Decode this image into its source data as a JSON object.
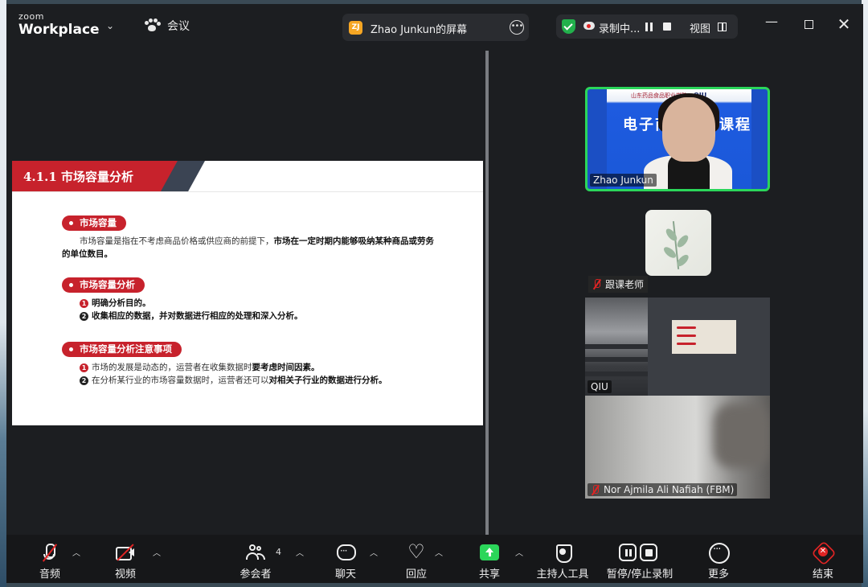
{
  "titlebar": {
    "brand_small": "zoom",
    "brand_big": "Workplace",
    "meeting_label": "会议",
    "share_badge": "ZJ",
    "share_title": "Zhao Junkun的屏幕",
    "recording_text": "录制中...",
    "view_label": "视图"
  },
  "slide": {
    "header": "4.1.1   市场容量分析",
    "s1_pill": "市场容量",
    "s1_text_plain": "市场容量是指在不考虑商品价格或供应商的前提下，",
    "s1_text_bold1": "市场在一定时期内能够吸纳某种商品或劳务",
    "s1_text_bold2": "的单位数目。",
    "s2_pill": "市场容量分析",
    "s2_item1": "明确分析目的。",
    "s2_item2": "收集相应的数据，并对数据进行相应的处理和深入分析。",
    "s3_pill": "市场容量分析注意事项",
    "s3_item1_plain": "市场的发展是动态的，运营者在收集数据时",
    "s3_item1_bold": "要考虑时间因素。",
    "s3_item2_plain": "在分析某行业的市场容量数据时，运营者还可以",
    "s3_item2_bold": "对相关子行业的数据进行分析。",
    "n1": "1",
    "n2": "2"
  },
  "gallery": {
    "tile1_name": "Zhao Junkun",
    "tile1_banner": "电子商务专业课程",
    "tile1_school": "山东药品食品职业学院",
    "tile1_corner": "QIU",
    "tile2_name": "跟课老师",
    "tile3_name": "QIU",
    "tile4_name": "Nor Ajmila Ali Nafiah (FBM)"
  },
  "toolbar": {
    "audio": "音频",
    "video": "视频",
    "participants": "参会者",
    "participants_count": "4",
    "chat": "聊天",
    "react": "回应",
    "share": "共享",
    "host_tools": "主持人工具",
    "record": "暂停/停止录制",
    "more": "更多",
    "end": "结束"
  },
  "colors": {
    "accent_green": "#2bd65a",
    "slide_red": "#c7222c",
    "end_red": "#e02424"
  }
}
